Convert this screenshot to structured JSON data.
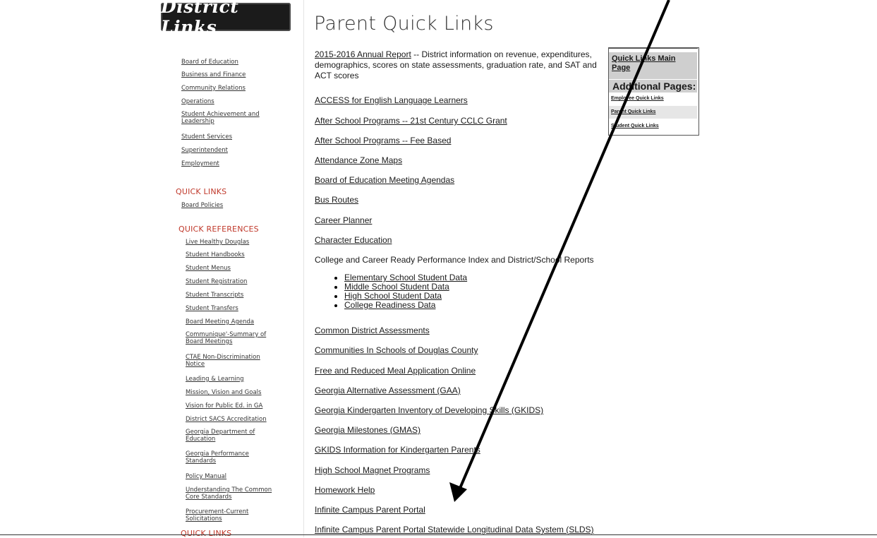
{
  "logo": {
    "text": "District Links"
  },
  "sidebar": {
    "top_links": [
      "Board of Education",
      "Business and Finance",
      "Community Relations",
      "Operations",
      "Student Achievement and Leadership",
      "Student Services",
      "Superintendent",
      "Employment"
    ],
    "quick_links_heading": "QUICK LINKS",
    "quick_links": [
      "Board Policies"
    ],
    "quick_references_heading": "QUICK REFERENCES",
    "quick_references": [
      "Live Healthy Douglas",
      "Student Handbooks",
      "Student Menus",
      "Student Registration",
      "Student Transcripts",
      "Student Transfers",
      "Board Meeting Agenda",
      "Communique'-Summary of Board Meetings",
      "CTAE Non-Discrimination Notice",
      "Leading & Learning",
      "Mission, Vision and Goals",
      "Vision for Public Ed. in GA",
      "District SACS Accreditation",
      "Georgia Department of Education",
      "Georgia Performance Standards",
      "Policy Manual",
      "Understanding The Common Core Standards",
      "Procurement-Current Solicitations"
    ],
    "bottom_heading": "QUICK LINKS"
  },
  "main": {
    "title": "Parent Quick Links",
    "annual_report_link": "2015-2016 Annual Report",
    "annual_report_desc": " -- District information on revenue, expenditures, demographics, scores on state assessments, graduation rate, and SAT and ACT scores",
    "links_a": [
      "ACCESS for English Language Learners",
      "After School Programs -- 21st Century CCLC Grant",
      "After School Programs -- Fee Based",
      "Attendance Zone Maps",
      "Board of Education Meeting Agendas",
      "Bus Routes",
      "Career Planner",
      "Character Education"
    ],
    "ccrpi_text": "College and Career Ready Performance Index and District/School Reports",
    "ccrpi_items": [
      "Elementary School Student Data",
      "Middle School Student Data",
      "High School Student Data",
      "College Readiness Data"
    ],
    "links_b": [
      "Common District Assessments",
      "Communities In Schools of Douglas County",
      "Free and Reduced Meal Application Online",
      "Georgia Alternative Assessment (GAA)",
      "Georgia Kindergarten Inventory of Developing Skills (GKIDS)",
      "Georgia Milestones (GMAS)",
      "GKIDS Information for Kindergarten Parents",
      "High School Magnet Programs",
      "Homework Help",
      "Infinite Campus Parent Portal",
      "Infinite Campus Parent Portal Statewide Longitudinal Data System (SLDS)"
    ]
  },
  "quick_box": {
    "main_link": "Quick Links Main Page",
    "header": "Additional Pages:",
    "items": [
      "Employee Quick Links",
      "Parent Quick Links",
      "Student Quick Links"
    ]
  },
  "colors": {
    "heading_red": "#c0392b",
    "box_gray": "#cfcfcf",
    "logo_bg": "#1b1b1b"
  }
}
